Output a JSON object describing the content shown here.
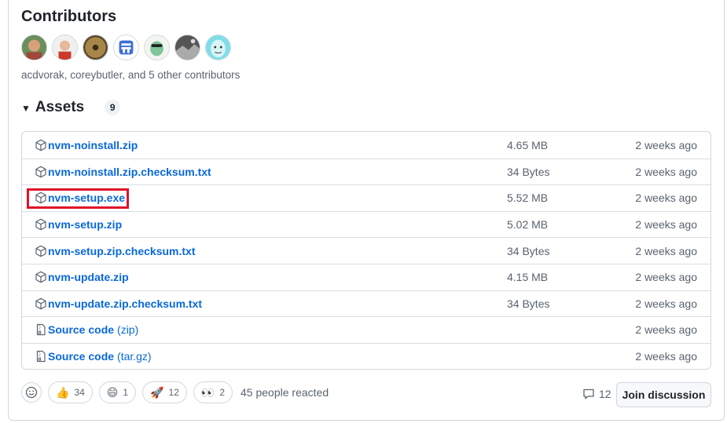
{
  "contributors": {
    "title": "Contributors",
    "avatars": [
      {
        "name": "acdvorak",
        "icon": "avatar-photo-man"
      },
      {
        "name": "coreybutler",
        "icon": "avatar-photo-man-2"
      },
      {
        "name": "contributor-3",
        "icon": "avatar-coin"
      },
      {
        "name": "contributor-4",
        "icon": "avatar-blue-logo"
      },
      {
        "name": "contributor-5",
        "icon": "avatar-cartoon"
      },
      {
        "name": "contributor-6",
        "icon": "avatar-photo-dark"
      },
      {
        "name": "contributor-7",
        "icon": "avatar-cartoon-face"
      }
    ],
    "summary": "acdvorak, coreybutler, and 5 other contributors"
  },
  "assets": {
    "title": "Assets",
    "count": "9",
    "rows": [
      {
        "name": "nvm-noinstall.zip",
        "sub": "",
        "size": "4.65 MB",
        "date": "2 weeks ago",
        "icon": "package-icon"
      },
      {
        "name": "nvm-noinstall.zip.checksum.txt",
        "sub": "",
        "size": "34 Bytes",
        "date": "2 weeks ago",
        "icon": "package-icon"
      },
      {
        "name": "nvm-setup.exe",
        "sub": "",
        "size": "5.52 MB",
        "date": "2 weeks ago",
        "icon": "package-icon",
        "highlighted": true
      },
      {
        "name": "nvm-setup.zip",
        "sub": "",
        "size": "5.02 MB",
        "date": "2 weeks ago",
        "icon": "package-icon"
      },
      {
        "name": "nvm-setup.zip.checksum.txt",
        "sub": "",
        "size": "34 Bytes",
        "date": "2 weeks ago",
        "icon": "package-icon"
      },
      {
        "name": "nvm-update.zip",
        "sub": "",
        "size": "4.15 MB",
        "date": "2 weeks ago",
        "icon": "package-icon"
      },
      {
        "name": "nvm-update.zip.checksum.txt",
        "sub": "",
        "size": "34 Bytes",
        "date": "2 weeks ago",
        "icon": "package-icon"
      },
      {
        "name": "Source code",
        "sub": "(zip)",
        "size": "",
        "date": "2 weeks ago",
        "icon": "file-zip-icon"
      },
      {
        "name": "Source code",
        "sub": "(tar.gz)",
        "size": "",
        "date": "2 weeks ago",
        "icon": "file-zip-icon"
      }
    ]
  },
  "reactions": {
    "items": [
      {
        "emoji": "👍",
        "icon": "thumbs-up",
        "count": "34"
      },
      {
        "emoji": "😄",
        "icon": "laugh",
        "count": "1"
      },
      {
        "emoji": "🚀",
        "icon": "rocket",
        "count": "12"
      },
      {
        "emoji": "👀",
        "icon": "eyes",
        "count": "2"
      }
    ],
    "summary": "45 people reacted"
  },
  "discussion": {
    "count": "12",
    "join_label": "Join discussion"
  },
  "colors": {
    "link": "#0969da",
    "muted": "#59636e",
    "border": "#d0d7de",
    "highlight": "#e0112a"
  }
}
